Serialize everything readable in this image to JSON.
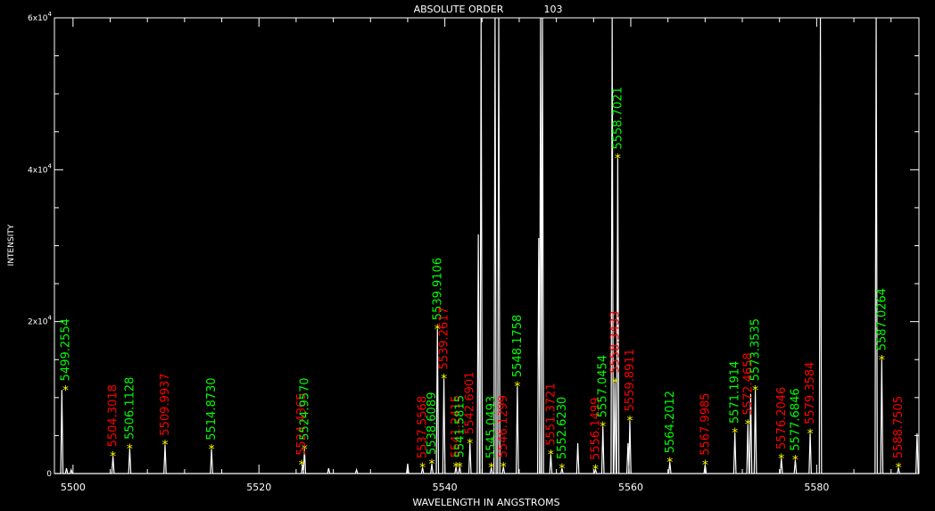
{
  "chart_data": {
    "type": "line",
    "title": "ABSOLUTE ORDER",
    "order_number": "103",
    "xlabel": "WAVELENGTH IN ANGSTROMS",
    "ylabel": "INTENSITY",
    "xlim": [
      5498,
      5591
    ],
    "ylim": [
      0,
      60000
    ],
    "x_ticks": [
      5500,
      5520,
      5540,
      5560,
      5580
    ],
    "x_tick_labels": [
      "5500",
      "5520",
      "5540",
      "5560",
      "5580"
    ],
    "y_ticks": [
      0,
      20000,
      40000,
      60000
    ],
    "y_tick_labels": [
      {
        "mantissa": "0",
        "exp": ""
      },
      {
        "mantissa": "2x10",
        "exp": "4"
      },
      {
        "mantissa": "4x10",
        "exp": "4"
      },
      {
        "mantissa": "6x10",
        "exp": "4"
      }
    ],
    "grid": false,
    "colors": {
      "background": "#000000",
      "spectrum": "#ffffff",
      "marker": "#ffff00",
      "green": "#00ff00",
      "red": "#ff0000"
    },
    "spectrum_peaks": [
      {
        "x": 5498.8,
        "y": 11000
      },
      {
        "x": 5499.3,
        "y": 700
      },
      {
        "x": 5499.8,
        "y": 500
      },
      {
        "x": 5504.3,
        "y": 2300
      },
      {
        "x": 5506.1,
        "y": 3300
      },
      {
        "x": 5509.9,
        "y": 3800
      },
      {
        "x": 5514.9,
        "y": 3200
      },
      {
        "x": 5524.7,
        "y": 1200
      },
      {
        "x": 5524.9,
        "y": 3200
      },
      {
        "x": 5527.5,
        "y": 700
      },
      {
        "x": 5530.5,
        "y": 500
      },
      {
        "x": 5536.0,
        "y": 1300
      },
      {
        "x": 5537.6,
        "y": 800
      },
      {
        "x": 5538.6,
        "y": 1300
      },
      {
        "x": 5539.2,
        "y": 19000
      },
      {
        "x": 5539.9,
        "y": 12500
      },
      {
        "x": 5541.2,
        "y": 900
      },
      {
        "x": 5541.6,
        "y": 900
      },
      {
        "x": 5542.7,
        "y": 4000
      },
      {
        "x": 5543.6,
        "y": 31500
      },
      {
        "x": 5543.9,
        "y": 60000
      },
      {
        "x": 5545.0,
        "y": 800
      },
      {
        "x": 5545.4,
        "y": 60000
      },
      {
        "x": 5545.8,
        "y": 60000
      },
      {
        "x": 5546.3,
        "y": 900
      },
      {
        "x": 5547.8,
        "y": 11500
      },
      {
        "x": 5550.1,
        "y": 31000
      },
      {
        "x": 5550.3,
        "y": 60000
      },
      {
        "x": 5550.5,
        "y": 60000
      },
      {
        "x": 5551.4,
        "y": 2500
      },
      {
        "x": 5552.6,
        "y": 700
      },
      {
        "x": 5554.3,
        "y": 4000
      },
      {
        "x": 5556.2,
        "y": 600
      },
      {
        "x": 5557.0,
        "y": 6200
      },
      {
        "x": 5558.0,
        "y": 60000
      },
      {
        "x": 5558.3,
        "y": 12000
      },
      {
        "x": 5558.6,
        "y": 41500
      },
      {
        "x": 5559.7,
        "y": 4000
      },
      {
        "x": 5559.9,
        "y": 7000
      },
      {
        "x": 5564.2,
        "y": 1500
      },
      {
        "x": 5568.0,
        "y": 1200
      },
      {
        "x": 5571.2,
        "y": 5400
      },
      {
        "x": 5572.6,
        "y": 6500
      },
      {
        "x": 5572.9,
        "y": 10500
      },
      {
        "x": 5573.4,
        "y": 11000
      },
      {
        "x": 5576.2,
        "y": 2000
      },
      {
        "x": 5577.7,
        "y": 1800
      },
      {
        "x": 5579.3,
        "y": 5300
      },
      {
        "x": 5580.4,
        "y": 60000
      },
      {
        "x": 5586.4,
        "y": 60000
      },
      {
        "x": 5587.0,
        "y": 15000
      },
      {
        "x": 5588.8,
        "y": 800
      },
      {
        "x": 5590.8,
        "y": 5300
      }
    ],
    "line_labels": [
      {
        "text": "5499.2554",
        "color": "green",
        "x": 5499.2,
        "y": 11000
      },
      {
        "text": "5504.3018",
        "color": "red",
        "x": 5504.3,
        "y": 2300
      },
      {
        "text": "5506.1128",
        "color": "green",
        "x": 5506.1,
        "y": 3300
      },
      {
        "text": "5509.9937",
        "color": "red",
        "x": 5509.9,
        "y": 3800
      },
      {
        "text": "5514.8730",
        "color": "green",
        "x": 5514.9,
        "y": 3200
      },
      {
        "text": "5524.4365",
        "color": "red",
        "x": 5524.6,
        "y": 1200
      },
      {
        "text": "5524.9570",
        "color": "green",
        "x": 5524.9,
        "y": 3200
      },
      {
        "text": "5537.5568",
        "color": "red",
        "x": 5537.6,
        "y": 800
      },
      {
        "text": "5538.6089",
        "color": "green",
        "x": 5538.6,
        "y": 1300
      },
      {
        "text": "5539.9106",
        "color": "green",
        "x": 5539.2,
        "y": 19000
      },
      {
        "text": "5539.2617",
        "color": "red",
        "x": 5539.9,
        "y": 12500
      },
      {
        "text": "5541.2415",
        "color": "red",
        "x": 5541.2,
        "y": 900
      },
      {
        "text": "5541.5815",
        "color": "green",
        "x": 5541.6,
        "y": 900
      },
      {
        "text": "5542.6901",
        "color": "red",
        "x": 5542.7,
        "y": 4000
      },
      {
        "text": "5545.0493",
        "color": "green",
        "x": 5545.0,
        "y": 800
      },
      {
        "text": "5546.1299",
        "color": "red",
        "x": 5546.3,
        "y": 900
      },
      {
        "text": "5548.1758",
        "color": "green",
        "x": 5547.8,
        "y": 11500
      },
      {
        "text": "5551.3721",
        "color": "red",
        "x": 5551.4,
        "y": 2500
      },
      {
        "text": "5552.6230",
        "color": "green",
        "x": 5552.6,
        "y": 700
      },
      {
        "text": "5556.1499",
        "color": "red",
        "x": 5556.2,
        "y": 600
      },
      {
        "text": "5557.0454",
        "color": "green",
        "x": 5557.0,
        "y": 6200
      },
      {
        "text": "5558.3433",
        "color": "red",
        "x": 5558.3,
        "y": 12000
      },
      {
        "text": "5558.7021",
        "color": "green",
        "x": 5558.6,
        "y": 41500
      },
      {
        "text": "5559.8911",
        "color": "red",
        "x": 5559.9,
        "y": 7000
      },
      {
        "text": "5564.2012",
        "color": "green",
        "x": 5564.2,
        "y": 1500
      },
      {
        "text": "5567.9985",
        "color": "red",
        "x": 5568.0,
        "y": 1200
      },
      {
        "text": "5571.1914",
        "color": "green",
        "x": 5571.2,
        "y": 5400
      },
      {
        "text": "5572.4658",
        "color": "red",
        "x": 5572.6,
        "y": 6500
      },
      {
        "text": "5573.3535",
        "color": "green",
        "x": 5573.4,
        "y": 11000
      },
      {
        "text": "5576.2046",
        "color": "red",
        "x": 5576.2,
        "y": 2000
      },
      {
        "text": "5577.6846",
        "color": "green",
        "x": 5577.7,
        "y": 1800
      },
      {
        "text": "5579.3584",
        "color": "red",
        "x": 5579.3,
        "y": 5300
      },
      {
        "text": "5587.0264",
        "color": "green",
        "x": 5587.0,
        "y": 15000
      },
      {
        "text": "5588.7505",
        "color": "red",
        "x": 5588.8,
        "y": 800
      }
    ]
  }
}
